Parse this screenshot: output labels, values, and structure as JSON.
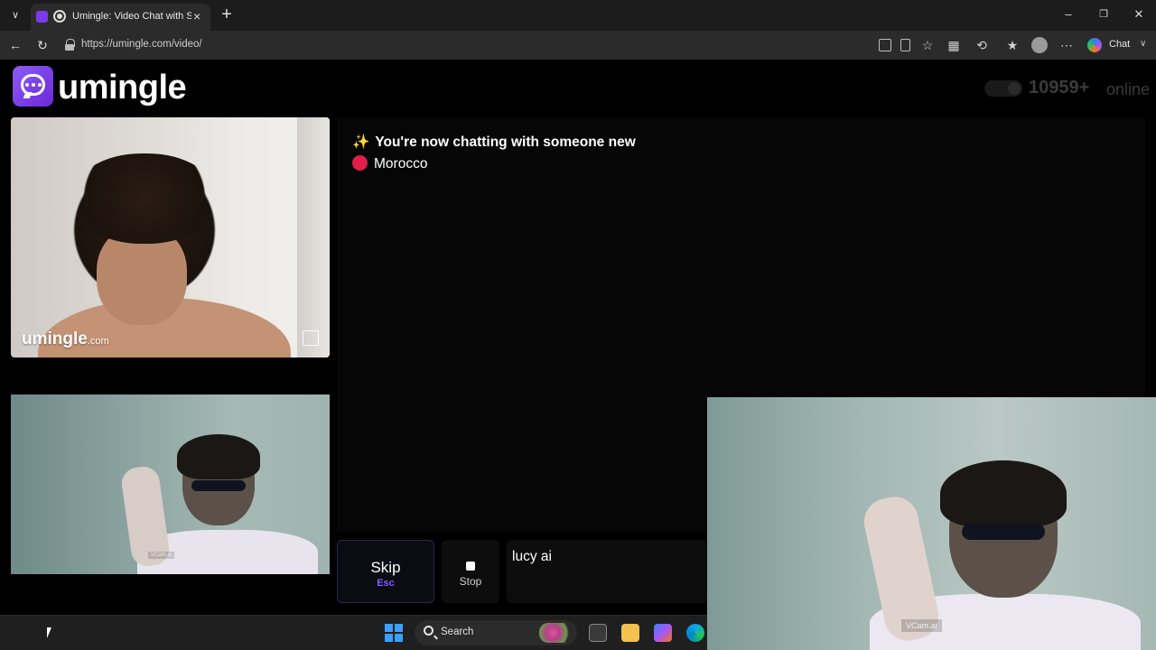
{
  "browser": {
    "tab_title": "Umingle: Video Chat with Stra",
    "url": "https://umingle.com/video/",
    "copilot_label": "Chat"
  },
  "header": {
    "logo_text": "umingle",
    "online_count": "10959+",
    "online_label": "online"
  },
  "stranger_video": {
    "watermark": "umingle",
    "watermark_suffix": ".com"
  },
  "self_video": {
    "watermark": "VCam.ai"
  },
  "chat": {
    "status_message": "You're now chatting with someone new",
    "country": "Morocco"
  },
  "controls": {
    "skip_label": "Skip",
    "skip_shortcut": "Esc",
    "stop_label": "Stop",
    "message_value": "lucy ai"
  },
  "overlay": {
    "watermark": "VCam.ai"
  },
  "taskbar": {
    "search_label": "Search"
  },
  "colors": {
    "brand": "#7c3aed",
    "accent_shortcut": "#7c5cff",
    "country_flag": "#e11d48"
  }
}
